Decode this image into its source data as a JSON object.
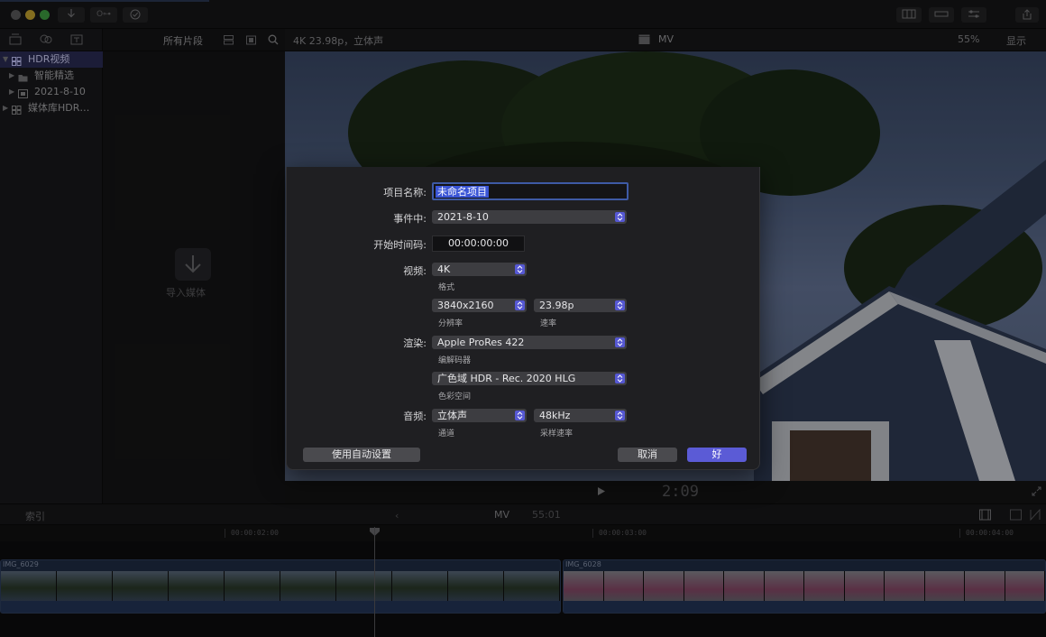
{
  "titlebar": {
    "key_button_label": "O⊶"
  },
  "library": {
    "items": [
      {
        "label": "HDR视频",
        "selected": true
      },
      {
        "label": "智能精选",
        "selected": false
      },
      {
        "label": "2021-8-10",
        "selected": false
      },
      {
        "label": "媒体库HDR…",
        "selected": false
      }
    ]
  },
  "browser": {
    "filter_label": "所有片段",
    "import_label": "导入媒体"
  },
  "viewer": {
    "format_label": "4K 23.98p，立体声",
    "project_label": "MV",
    "zoom_label": "55%",
    "show_label": "显示",
    "timecode": "2:09"
  },
  "timeline": {
    "index_label": "索引",
    "project_label": "MV",
    "duration": "55:01",
    "ruler": [
      "00:00:02:00",
      "00:00:03:00",
      "00:00:04:00"
    ],
    "clips": [
      {
        "name": "IMG_6029"
      },
      {
        "name": "IMG_6028"
      }
    ]
  },
  "dialog": {
    "project_name_label": "项目名称:",
    "project_name_value": "未命名项目",
    "event_label": "事件中:",
    "event_value": "2021-8-10",
    "start_tc_label": "开始时间码:",
    "start_tc_value": "00:00:00:00",
    "video_label": "视频:",
    "video_format_value": "4K",
    "video_format_caption": "格式",
    "resolution_value": "3840x2160",
    "resolution_caption": "分辨率",
    "rate_value": "23.98p",
    "rate_caption": "速率",
    "render_label": "渲染:",
    "codec_value": "Apple ProRes 422",
    "codec_caption": "编解码器",
    "colorspace_value": "广色域 HDR - Rec. 2020 HLG",
    "colorspace_caption": "色彩空间",
    "audio_label": "音频:",
    "channels_value": "立体声",
    "channels_caption": "通道",
    "samplerate_value": "48kHz",
    "samplerate_caption": "采样速率",
    "auto_settings_button": "使用自动设置",
    "cancel_button": "取消",
    "ok_button": "好"
  },
  "colors": {
    "accent": "#5b5bd6",
    "selection": "#3a55d6",
    "sheet_bg": "#1f1f22"
  }
}
